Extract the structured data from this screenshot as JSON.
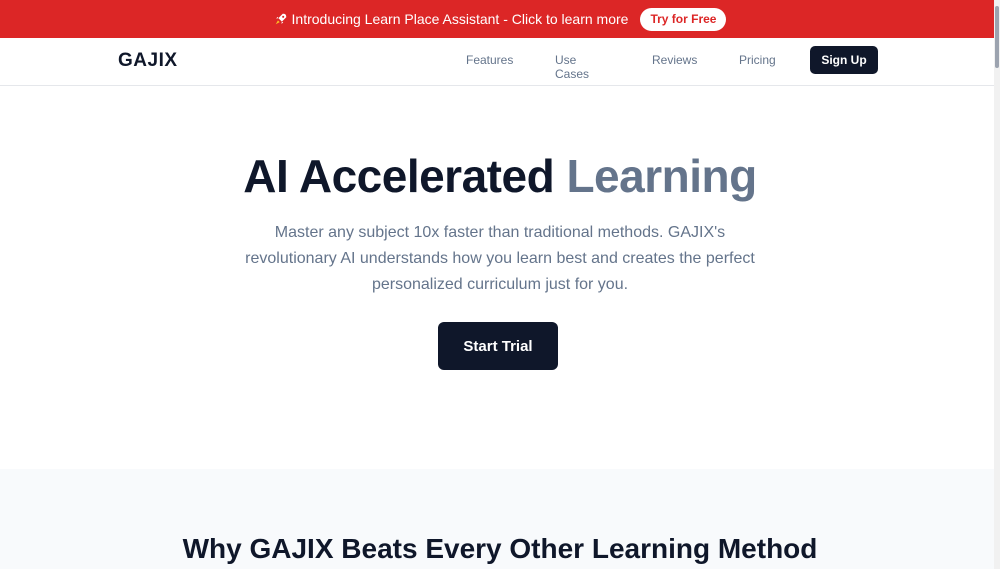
{
  "announcement": {
    "icon": "rocket-icon",
    "text": "Introducing Learn Place Assistant - Click to learn more",
    "cta": "Try for Free"
  },
  "nav": {
    "logo": "GAJIX",
    "links": [
      "Features",
      "Use Cases",
      "Reviews",
      "Pricing"
    ],
    "signup": "Sign Up"
  },
  "hero": {
    "title_main": "AI Accelerated",
    "title_accent": "Learning",
    "subtitle": "Master any subject 10x faster than traditional methods. GAJIX's revolutionary AI understands how you learn best and creates the perfect personalized curriculum just for you.",
    "cta": "Start Trial"
  },
  "why": {
    "title": "Why GAJIX Beats Every Other Learning Method"
  },
  "colors": {
    "announcement_bg": "#dc2626",
    "primary_dark": "#0f172a",
    "muted": "#64748b"
  }
}
